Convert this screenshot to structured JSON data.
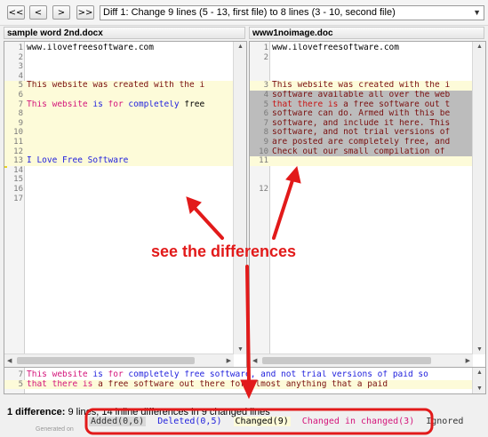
{
  "toolbar": {
    "first": "<<",
    "prev": "<",
    "next": ">",
    "last": ">>",
    "diff_select": "Diff 1: Change 9 lines (5 - 13, first file) to 8 lines (3 - 10, second file)"
  },
  "left": {
    "title": "sample word 2nd.docx",
    "lines": [
      {
        "n": "1",
        "parts": [
          {
            "t": "www.ilovefreesoftware.com",
            "c": ""
          }
        ],
        "hl": ""
      },
      {
        "n": "2",
        "parts": [],
        "hl": ""
      },
      {
        "n": "3",
        "parts": [],
        "hl": ""
      },
      {
        "n": "4",
        "parts": [],
        "hl": ""
      },
      {
        "n": "5",
        "parts": [
          {
            "t": "This website was created with the i",
            "c": "brown"
          }
        ],
        "hl": "y"
      },
      {
        "n": "6",
        "parts": [],
        "hl": "y"
      },
      {
        "n": "7",
        "parts": [
          {
            "t": "This website ",
            "c": "pink"
          },
          {
            "t": "is ",
            "c": "blue"
          },
          {
            "t": "for ",
            "c": "pink"
          },
          {
            "t": "completely ",
            "c": "blue"
          },
          {
            "t": "free",
            "c": ""
          }
        ],
        "hl": "y"
      },
      {
        "n": "8",
        "parts": [],
        "hl": "y"
      },
      {
        "n": "9",
        "parts": [],
        "hl": "y"
      },
      {
        "n": "10",
        "parts": [],
        "hl": "y"
      },
      {
        "n": "11",
        "parts": [],
        "hl": "y"
      },
      {
        "n": "12",
        "parts": [],
        "hl": "y"
      },
      {
        "n": "13",
        "parts": [
          {
            "t": "I Love Free Software",
            "c": "blue"
          }
        ],
        "hl": "y"
      },
      {
        "n": "14",
        "parts": [],
        "hl": ""
      },
      {
        "n": "15",
        "parts": [],
        "hl": ""
      },
      {
        "n": "16",
        "parts": [],
        "hl": ""
      },
      {
        "n": "17",
        "parts": [],
        "hl": ""
      }
    ]
  },
  "right": {
    "title": "www1noimage.doc",
    "lines": [
      {
        "n": "1",
        "parts": [
          {
            "t": "www.ilovefreesoftware.com",
            "c": ""
          }
        ],
        "hl": ""
      },
      {
        "n": "2",
        "parts": [],
        "hl": ""
      },
      {
        "n": "",
        "parts": [],
        "hl": ""
      },
      {
        "n": "",
        "parts": [],
        "hl": ""
      },
      {
        "n": "3",
        "parts": [
          {
            "t": "This website was created with the i",
            "c": "brown"
          }
        ],
        "hl": "y"
      },
      {
        "n": "4",
        "parts": [
          {
            "t": "software available all over the web",
            "c": "brown"
          }
        ],
        "hl": "g"
      },
      {
        "n": "5",
        "parts": [
          {
            "t": "that there is ",
            "c": "red"
          },
          {
            "t": "a free software out t",
            "c": "brown"
          }
        ],
        "hl": "g"
      },
      {
        "n": "6",
        "parts": [
          {
            "t": "software can do. Armed with this be",
            "c": "brown"
          }
        ],
        "hl": "g"
      },
      {
        "n": "7",
        "parts": [
          {
            "t": "software, and include it here. This",
            "c": "brown"
          }
        ],
        "hl": "g"
      },
      {
        "n": "8",
        "parts": [
          {
            "t": "software, and not trial versions of",
            "c": "brown"
          }
        ],
        "hl": "g"
      },
      {
        "n": "9",
        "parts": [
          {
            "t": "are posted are completely free, and",
            "c": "brown"
          }
        ],
        "hl": "g"
      },
      {
        "n": "10",
        "parts": [
          {
            "t": "Check out our small compilation of",
            "c": "brown"
          }
        ],
        "hl": "g"
      },
      {
        "n": "11",
        "parts": [],
        "hl": "y"
      },
      {
        "n": "",
        "parts": [],
        "hl": ""
      },
      {
        "n": "",
        "parts": [],
        "hl": ""
      },
      {
        "n": "12",
        "parts": [],
        "hl": ""
      }
    ]
  },
  "bottom": {
    "lines": [
      {
        "n": "7",
        "parts": [
          {
            "t": "This website ",
            "c": "pink"
          },
          {
            "t": "is ",
            "c": "blue"
          },
          {
            "t": "for ",
            "c": "pink"
          },
          {
            "t": "completely free software, and not trial versions of paid so",
            "c": "blue"
          }
        ],
        "hl": ""
      },
      {
        "n": "5",
        "parts": [
          {
            "t": "that there is ",
            "c": "pink"
          },
          {
            "t": "a free software out there for almost anything that a paid",
            "c": "brown"
          }
        ],
        "hl": "y"
      }
    ]
  },
  "status": {
    "bold": "1 difference:",
    "rest": " 9 lines, 14 inline differences in 9 changed lines"
  },
  "legend": {
    "added": "Added(0,6)",
    "deleted": "Deleted(0,5)",
    "changed": "Changed(9)",
    "changed_in_changed": "Changed in changed(3)",
    "ignored": "Ignored"
  },
  "footer_note": "Generated on",
  "annotation": {
    "text": "see the differences",
    "color": "#e21a1a"
  }
}
